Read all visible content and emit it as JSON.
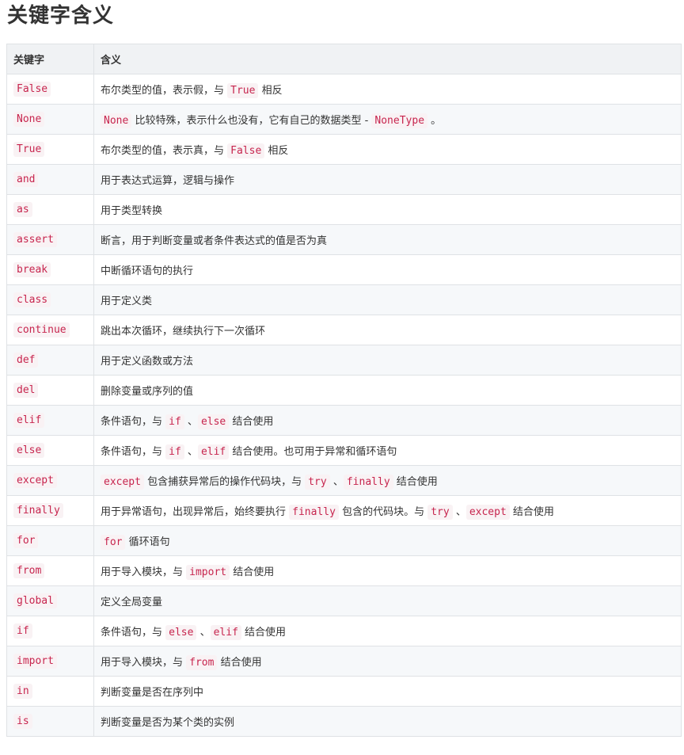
{
  "title": "关键字含义",
  "table": {
    "headers": [
      "关键字",
      "含义"
    ],
    "rows": [
      {
        "keyword": "False",
        "desc": [
          {
            "t": "text",
            "v": "布尔类型的值，表示假，与 "
          },
          {
            "t": "code",
            "v": "True"
          },
          {
            "t": "text",
            "v": " 相反"
          }
        ]
      },
      {
        "keyword": "None",
        "desc": [
          {
            "t": "code",
            "v": "None"
          },
          {
            "t": "text",
            "v": " 比较特殊，表示什么也没有，它有自己的数据类型 - "
          },
          {
            "t": "code",
            "v": "NoneType"
          },
          {
            "t": "text",
            "v": " 。"
          }
        ]
      },
      {
        "keyword": "True",
        "desc": [
          {
            "t": "text",
            "v": "布尔类型的值，表示真，与 "
          },
          {
            "t": "code",
            "v": "False"
          },
          {
            "t": "text",
            "v": " 相反"
          }
        ]
      },
      {
        "keyword": "and",
        "desc": [
          {
            "t": "text",
            "v": "用于表达式运算，逻辑与操作"
          }
        ]
      },
      {
        "keyword": "as",
        "desc": [
          {
            "t": "text",
            "v": "用于类型转换"
          }
        ]
      },
      {
        "keyword": "assert",
        "desc": [
          {
            "t": "text",
            "v": "断言，用于判断变量或者条件表达式的值是否为真"
          }
        ]
      },
      {
        "keyword": "break",
        "desc": [
          {
            "t": "text",
            "v": "中断循环语句的执行"
          }
        ]
      },
      {
        "keyword": "class",
        "desc": [
          {
            "t": "text",
            "v": "用于定义类"
          }
        ]
      },
      {
        "keyword": "continue",
        "desc": [
          {
            "t": "text",
            "v": "跳出本次循环，继续执行下一次循环"
          }
        ]
      },
      {
        "keyword": "def",
        "desc": [
          {
            "t": "text",
            "v": "用于定义函数或方法"
          }
        ]
      },
      {
        "keyword": "del",
        "desc": [
          {
            "t": "text",
            "v": "删除变量或序列的值"
          }
        ]
      },
      {
        "keyword": "elif",
        "desc": [
          {
            "t": "text",
            "v": "条件语句，与 "
          },
          {
            "t": "code",
            "v": "if"
          },
          {
            "t": "text",
            "v": " 、"
          },
          {
            "t": "code",
            "v": "else"
          },
          {
            "t": "text",
            "v": " 结合使用"
          }
        ]
      },
      {
        "keyword": "else",
        "desc": [
          {
            "t": "text",
            "v": "条件语句，与 "
          },
          {
            "t": "code",
            "v": "if"
          },
          {
            "t": "text",
            "v": " 、"
          },
          {
            "t": "code",
            "v": "elif"
          },
          {
            "t": "text",
            "v": " 结合使用。也可用于异常和循环语句"
          }
        ]
      },
      {
        "keyword": "except",
        "desc": [
          {
            "t": "code",
            "v": "except"
          },
          {
            "t": "text",
            "v": " 包含捕获异常后的操作代码块，与 "
          },
          {
            "t": "code",
            "v": "try"
          },
          {
            "t": "text",
            "v": " 、"
          },
          {
            "t": "code",
            "v": "finally"
          },
          {
            "t": "text",
            "v": " 结合使用"
          }
        ]
      },
      {
        "keyword": "finally",
        "desc": [
          {
            "t": "text",
            "v": "用于异常语句，出现异常后，始终要执行 "
          },
          {
            "t": "code",
            "v": "finally"
          },
          {
            "t": "text",
            "v": " 包含的代码块。与 "
          },
          {
            "t": "code",
            "v": "try"
          },
          {
            "t": "text",
            "v": " 、"
          },
          {
            "t": "code",
            "v": "except"
          },
          {
            "t": "text",
            "v": " 结合使用"
          }
        ]
      },
      {
        "keyword": "for",
        "desc": [
          {
            "t": "code",
            "v": "for"
          },
          {
            "t": "text",
            "v": " 循环语句"
          }
        ]
      },
      {
        "keyword": "from",
        "desc": [
          {
            "t": "text",
            "v": "用于导入模块，与 "
          },
          {
            "t": "code",
            "v": "import"
          },
          {
            "t": "text",
            "v": " 结合使用"
          }
        ]
      },
      {
        "keyword": "global",
        "desc": [
          {
            "t": "text",
            "v": "定义全局变量"
          }
        ]
      },
      {
        "keyword": "if",
        "desc": [
          {
            "t": "text",
            "v": "条件语句，与 "
          },
          {
            "t": "code",
            "v": "else"
          },
          {
            "t": "text",
            "v": " 、"
          },
          {
            "t": "code",
            "v": "elif"
          },
          {
            "t": "text",
            "v": " 结合使用"
          }
        ]
      },
      {
        "keyword": "import",
        "desc": [
          {
            "t": "text",
            "v": "用于导入模块，与 "
          },
          {
            "t": "code",
            "v": "from"
          },
          {
            "t": "text",
            "v": " 结合使用"
          }
        ]
      },
      {
        "keyword": "in",
        "desc": [
          {
            "t": "text",
            "v": "判断变量是否在序列中"
          }
        ]
      },
      {
        "keyword": "is",
        "desc": [
          {
            "t": "text",
            "v": "判断变量是否为某个类的实例"
          }
        ]
      }
    ]
  },
  "colors": {
    "code_text": "#c7254e",
    "code_bg": "#f9f2f4",
    "header_bg": "#f0f2f4",
    "stripe_bg": "#f6f8fa",
    "border": "#dfe2e5"
  }
}
